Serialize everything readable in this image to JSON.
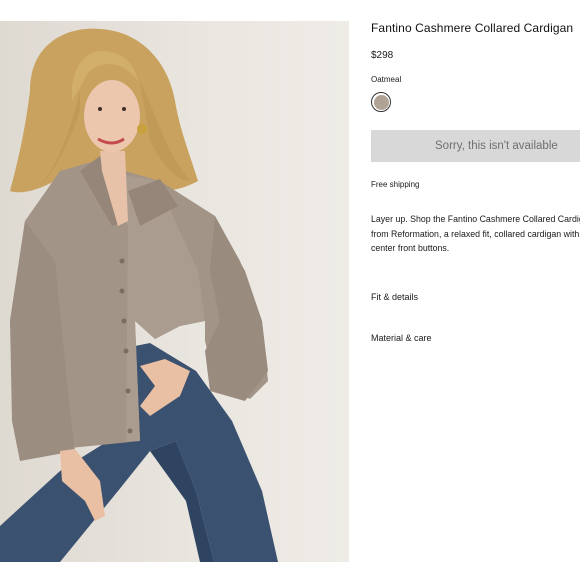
{
  "product": {
    "title": "Fantino Cashmere Collared Cardigan",
    "price": "$298",
    "color_name": "Oatmeal",
    "swatch_color": "#b1a296",
    "availability_button": "Sorry, this isn't available",
    "shipping": "Free shipping",
    "description": "Layer up. Shop the Fantino Cashmere Collared Cardigan from Reformation, a relaxed fit, collared cardigan with center front buttons.",
    "accordions": [
      {
        "label": "Fit & details"
      },
      {
        "label": "Material & care"
      }
    ]
  },
  "image": {
    "subject": "model-wearing-cardigan",
    "background_color": "#e6e2dc",
    "garment_color": "#a39488",
    "jeans_color": "#3b5170",
    "hair_color": "#cfa763"
  }
}
